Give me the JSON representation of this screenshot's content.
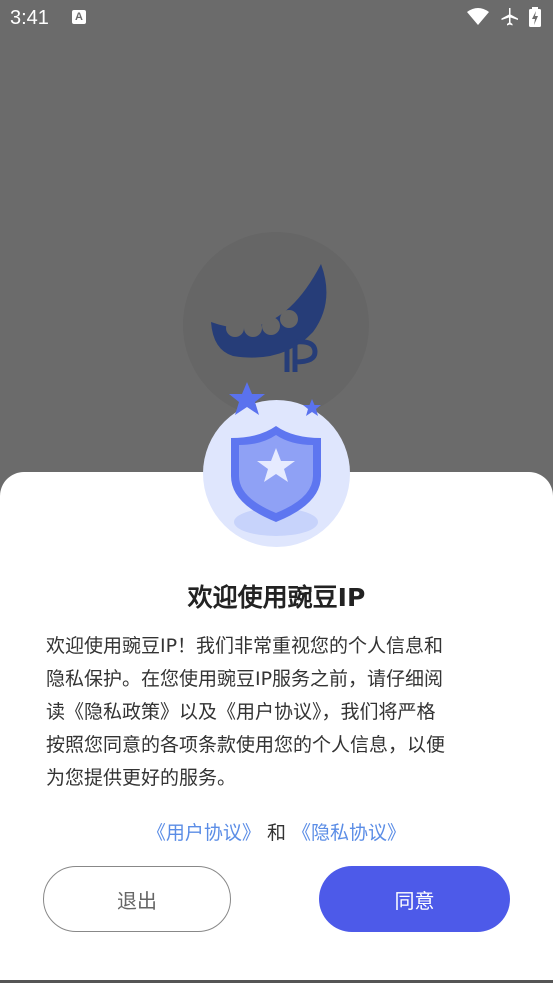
{
  "status_bar": {
    "time": "3:41",
    "notification_label": "A"
  },
  "dialog": {
    "title": "欢迎使用豌豆IP",
    "paragraph": [
      "欢迎使用豌豆IP！我们非常重视您的个人信息和",
      "隐私保护。在您使用豌豆IP服务之前，请仔细阅",
      "读《隐私政策》以及《用户协议》，我们将严格",
      "按照您同意的各项条款使用您的个人信息，以便",
      "为您提供更好的服务。"
    ],
    "user_agreement_link": "《用户协议》",
    "and_text": "和",
    "privacy_agreement_link": "《隐私协议》",
    "exit_label": "退出",
    "agree_label": "同意"
  },
  "colors": {
    "accent": "#4d5ae9",
    "link": "#5b8de6",
    "overlay": "#6b6b6b"
  }
}
